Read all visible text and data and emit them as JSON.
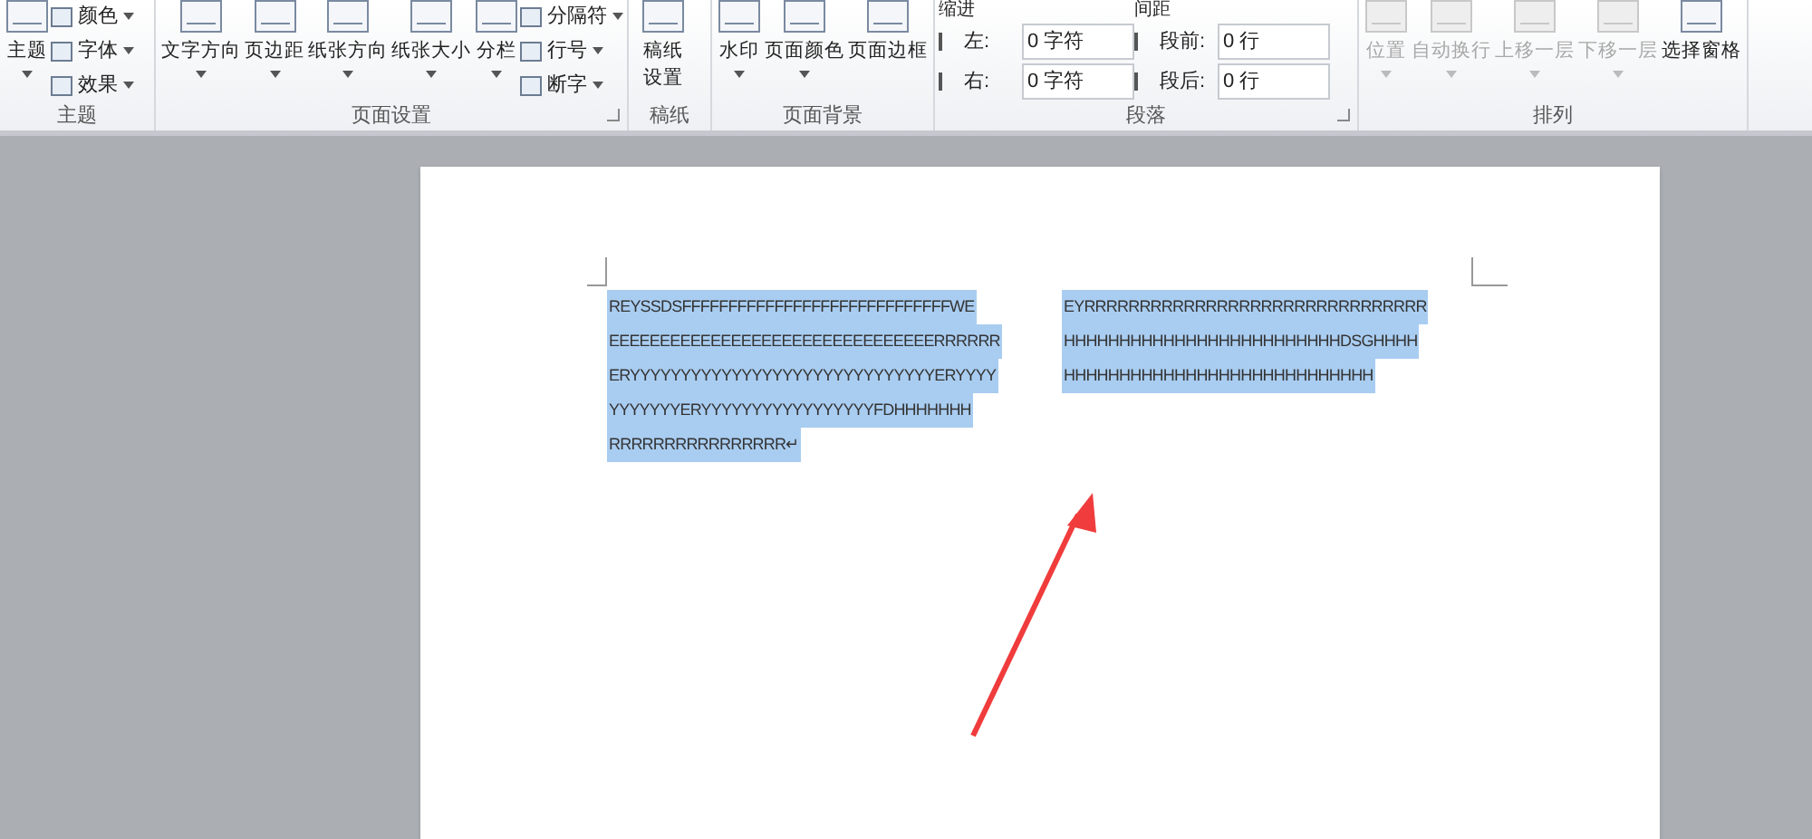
{
  "ribbon": {
    "groups": [
      {
        "label": "主题",
        "kind": "theme",
        "launcher": false,
        "big_buttons": [
          {
            "label": "主题",
            "dropdown": true,
            "disabled": false
          }
        ],
        "small_buttons": [
          {
            "label": "颜色",
            "dropdown": true
          },
          {
            "label": "字体",
            "dropdown": true
          },
          {
            "label": "效果",
            "dropdown": true
          }
        ]
      },
      {
        "label": "页面设置",
        "kind": "buttons",
        "launcher": true,
        "big_buttons": [
          {
            "label": "文字方向",
            "dropdown": true,
            "disabled": false
          },
          {
            "label": "页边距",
            "dropdown": true,
            "disabled": false
          },
          {
            "label": "纸张方向",
            "dropdown": true,
            "disabled": false
          },
          {
            "label": "纸张大小",
            "dropdown": true,
            "disabled": false
          },
          {
            "label": "分栏",
            "dropdown": true,
            "disabled": false
          }
        ],
        "small_buttons": [
          {
            "label": "分隔符",
            "dropdown": true
          },
          {
            "label": "行号",
            "dropdown": true
          },
          {
            "label": "断字",
            "dropdown": true
          }
        ]
      },
      {
        "label": "稿纸",
        "kind": "narrow",
        "launcher": false,
        "big_buttons": [
          {
            "label": "稿纸设置",
            "dropdown": false,
            "disabled": false
          }
        ]
      },
      {
        "label": "页面背景",
        "kind": "buttons",
        "launcher": false,
        "big_buttons": [
          {
            "label": "水印",
            "dropdown": true,
            "disabled": false
          },
          {
            "label": "页面颜色",
            "dropdown": true,
            "disabled": false
          },
          {
            "label": "页面边框",
            "dropdown": false,
            "disabled": false
          }
        ]
      },
      {
        "label": "段落",
        "kind": "paragraph",
        "launcher": true,
        "sections": [
          {
            "heading": "缩进",
            "fields": [
              {
                "label": "左:",
                "value": "0 字符"
              },
              {
                "label": "右:",
                "value": "0 字符"
              }
            ]
          },
          {
            "heading": "间距",
            "fields": [
              {
                "label": "段前:",
                "value": "0 行"
              },
              {
                "label": "段后:",
                "value": "0 行"
              }
            ]
          }
        ]
      },
      {
        "label": "排列",
        "kind": "buttons",
        "launcher": false,
        "big_buttons": [
          {
            "label": "位置",
            "dropdown": true,
            "disabled": true
          },
          {
            "label": "自动换行",
            "dropdown": true,
            "disabled": true
          },
          {
            "label": "上移一层",
            "dropdown": true,
            "disabled": true
          },
          {
            "label": "下移一层",
            "dropdown": true,
            "disabled": true
          },
          {
            "label": "选择窗格",
            "dropdown": false,
            "disabled": false
          }
        ]
      }
    ]
  },
  "document": {
    "columns": [
      {
        "selected": true,
        "lines": [
          "REYSSDSFFFFFFFFFFFFFFFFFFFFFFFFFFFFFWE",
          "EEEEEEEEEEEEEEEEEEEEEEEEEEEEEEEERRRRRR",
          "ERYYYYYYYYYYYYYYYYYYYYYYYYYYYYYYERYYYY",
          "YYYYYYYERYYYYYYYYYYYYYYYYYFDHHHHHHH",
          "RRRRRRRRRRRRRRRR↵"
        ]
      },
      {
        "selected": true,
        "lines": [
          "EYRRRRRRRRRRRRRRRRRRRRRRRRRRRRRRR",
          "HHHHHHHHHHHHHHHHHHHHHHHHHDSGHHHH",
          "HHHHHHHHHHHHHHHHHHHHHHHHHHHH"
        ]
      }
    ]
  }
}
